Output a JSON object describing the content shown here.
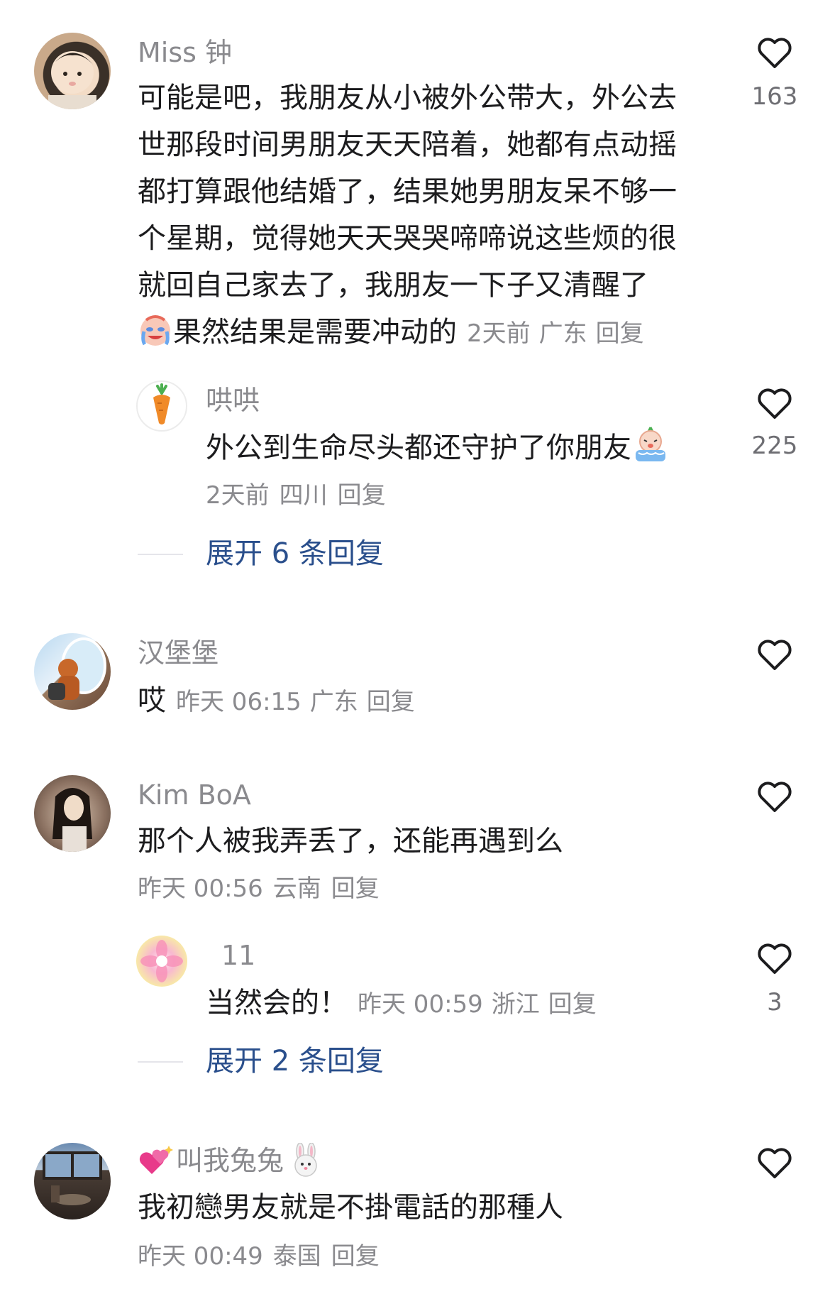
{
  "comments": [
    {
      "user": "Miss 钟",
      "lines": [
        "可能是吧，我朋友从小被外公带大，外公去",
        "世那段时间男朋友天天陪着，她都有点动摇",
        "都打算跟他结婚了，结果她男朋友呆不够一",
        "个星期，觉得她天天哭哭啼啼说这些烦的很",
        "就回自己家去了，我朋友一下子又清醒了",
        "果然结果是需要冲动的"
      ],
      "time": "2天前",
      "location": "广东",
      "reply_label": "回复",
      "likes": "163",
      "emoji": "crying-face-emoji"
    },
    {
      "user": "哄哄",
      "text": "外公到生命尽头都还守护了你朋友",
      "time": "2天前",
      "location": "四川",
      "reply_label": "回复",
      "likes": "225",
      "emoji": "crying-bun-emoji"
    },
    {
      "expand": "展开 6 条回复"
    },
    {
      "user": "汉堡堡",
      "text": "哎",
      "time": "昨天 06:15",
      "location": "广东",
      "reply_label": "回复"
    },
    {
      "user": "Kim BoA",
      "text": "那个人被我弄丢了，还能再遇到么",
      "time": "昨天 00:56",
      "location": "云南",
      "reply_label": "回复"
    },
    {
      "user": "11",
      "text": "当然会的！",
      "time": "昨天 00:59",
      "location": "浙江",
      "reply_label": "回复",
      "likes": "3"
    },
    {
      "expand": "展开 2 条回复"
    },
    {
      "user": "叫我兔兔",
      "text": "我初戀男友就是不掛電話的那種人",
      "time": "昨天 00:49",
      "location": "泰国",
      "reply_label": "回复"
    }
  ],
  "colors": {
    "name": "#8a8a8e",
    "text": "#1c1c1e",
    "link": "#2a4f8c",
    "heart_stroke": "#1c1c1e"
  },
  "icons": [
    "heart-outline-icon",
    "sparkling-heart-emoji",
    "rabbit-face-emoji",
    "carrot-avatar"
  ]
}
